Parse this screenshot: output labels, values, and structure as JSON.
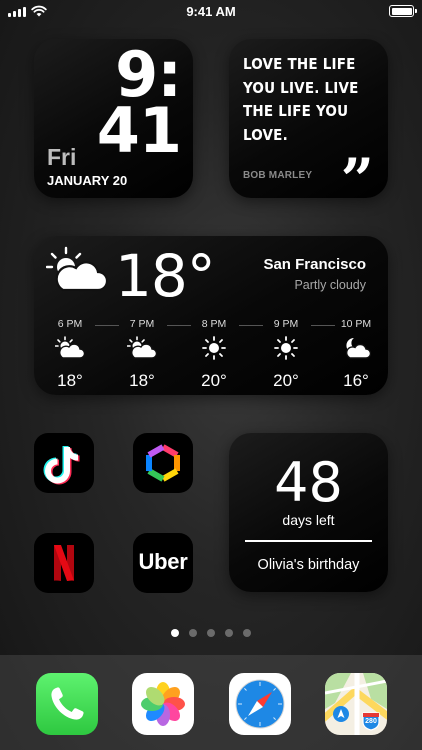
{
  "status_bar": {
    "time": "9:41 AM"
  },
  "clock_widget": {
    "hour": "9:",
    "minutes": "41",
    "day": "Fri",
    "date": "JANUARY 20"
  },
  "quote_widget": {
    "text": "LOVE THE LIFE YOU LIVE. LIVE THE LIFE YOU LOVE.",
    "author": "BOB MARLEY",
    "mark": "”"
  },
  "weather_widget": {
    "temperature": "18°",
    "city": "San Francisco",
    "condition": "Partly cloudy",
    "hourly": [
      {
        "time": "6 PM",
        "temp": "18°",
        "icon": "partly-cloudy"
      },
      {
        "time": "7 PM",
        "temp": "18°",
        "icon": "partly-cloudy"
      },
      {
        "time": "8 PM",
        "temp": "20°",
        "icon": "sunny"
      },
      {
        "time": "9 PM",
        "temp": "20°",
        "icon": "sunny"
      },
      {
        "time": "10 PM",
        "temp": "16°",
        "icon": "moon-cloudy"
      }
    ]
  },
  "apps": [
    {
      "name": "TikTok",
      "icon": "tiktok-icon"
    },
    {
      "name": "Photo Editor",
      "icon": "hexagon-lens-icon"
    },
    {
      "name": "Netflix",
      "icon": "netflix-icon",
      "glyph": "N"
    },
    {
      "name": "Uber",
      "icon": "uber-icon",
      "label": "Uber"
    }
  ],
  "countdown_widget": {
    "number": "48",
    "label": "days left",
    "event": "Olivia's birthday"
  },
  "page_dots": {
    "count": 5,
    "active": 0
  },
  "dock": [
    {
      "name": "Phone",
      "icon": "phone-icon"
    },
    {
      "name": "Photos",
      "icon": "photos-icon"
    },
    {
      "name": "Safari",
      "icon": "safari-icon"
    },
    {
      "name": "Maps",
      "icon": "maps-icon",
      "shield": "280"
    }
  ],
  "colors": {
    "phone_green": "#35d150",
    "netflix_red": "#e50914",
    "safari_blue": "#1e88e5"
  }
}
